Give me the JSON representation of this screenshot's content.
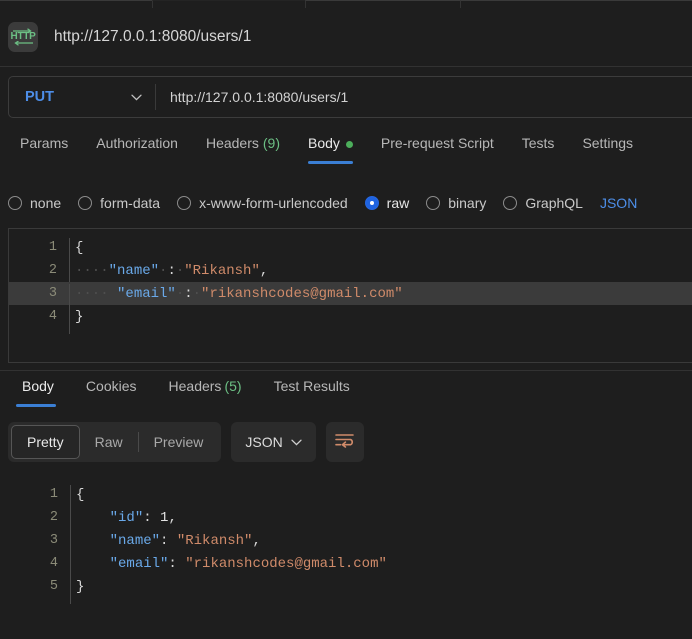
{
  "window": {
    "request_title": "http://127.0.0.1:8080/users/1",
    "protocol_icon_label": "HTTP"
  },
  "urlbar": {
    "method": "PUT",
    "method_dropdown_icon": "chevron-down-icon",
    "url_value": "http://127.0.0.1:8080/users/1"
  },
  "request_tabs": [
    {
      "label": "Params",
      "count": "",
      "active": false,
      "dot": false
    },
    {
      "label": "Authorization",
      "count": "",
      "active": false,
      "dot": false
    },
    {
      "label": "Headers",
      "count": "(9)",
      "active": false,
      "dot": false
    },
    {
      "label": "Body",
      "count": "",
      "active": true,
      "dot": true
    },
    {
      "label": "Pre-request Script",
      "count": "",
      "active": false,
      "dot": false
    },
    {
      "label": "Tests",
      "count": "",
      "active": false,
      "dot": false
    },
    {
      "label": "Settings",
      "count": "",
      "active": false,
      "dot": false
    }
  ],
  "body_type_options": [
    {
      "label": "none",
      "selected": false
    },
    {
      "label": "form-data",
      "selected": false
    },
    {
      "label": "x-www-form-urlencoded",
      "selected": false
    },
    {
      "label": "raw",
      "selected": true
    },
    {
      "label": "binary",
      "selected": false
    },
    {
      "label": "GraphQL",
      "selected": false
    }
  ],
  "body_format_chip": "JSON",
  "request_body": {
    "lines": [
      {
        "n": "1",
        "tokens": [
          {
            "t": "punct",
            "v": "{"
          }
        ],
        "highlight": false,
        "guide": true
      },
      {
        "n": "2",
        "tokens": [
          {
            "t": "ws",
            "v": "····"
          },
          {
            "t": "key",
            "v": "\"name\""
          },
          {
            "t": "ws",
            "v": "·"
          },
          {
            "t": "punct",
            "v": ":"
          },
          {
            "t": "ws",
            "v": "·"
          },
          {
            "t": "str",
            "v": "\"Rikansh\""
          },
          {
            "t": "punct",
            "v": ","
          }
        ],
        "highlight": false,
        "guide": true
      },
      {
        "n": "3",
        "tokens": [
          {
            "t": "ws",
            "v": "····"
          },
          {
            "t": "key",
            "v": " \"email\""
          },
          {
            "t": "ws",
            "v": "·"
          },
          {
            "t": "punct",
            "v": ":"
          },
          {
            "t": "ws",
            "v": "·"
          },
          {
            "t": "str",
            "v": "\"rikanshcodes@gmail.com\""
          }
        ],
        "highlight": true,
        "guide": true
      },
      {
        "n": "4",
        "tokens": [
          {
            "t": "punct",
            "v": "}"
          }
        ],
        "highlight": false,
        "guide": true
      }
    ]
  },
  "response_tabs": [
    {
      "label": "Body",
      "count": "",
      "active": true
    },
    {
      "label": "Cookies",
      "count": "",
      "active": false
    },
    {
      "label": "Headers",
      "count": "(5)",
      "active": false
    },
    {
      "label": "Test Results",
      "count": "",
      "active": false
    }
  ],
  "response_toolbar": {
    "view_modes": [
      {
        "label": "Pretty",
        "active": true
      },
      {
        "label": "Raw",
        "active": false
      },
      {
        "label": "Preview",
        "active": false
      }
    ],
    "format": "JSON",
    "format_dropdown_icon": "chevron-down-icon",
    "wrap_button_icon": "word-wrap-icon"
  },
  "response_body": {
    "lines": [
      {
        "n": "1",
        "tokens": [
          {
            "t": "punct",
            "v": "{"
          }
        ],
        "guide": true
      },
      {
        "n": "2",
        "tokens": [
          {
            "t": "ws",
            "v": "    "
          },
          {
            "t": "key",
            "v": "\"id\""
          },
          {
            "t": "punct",
            "v": ":"
          },
          {
            "t": "ws",
            "v": " "
          },
          {
            "t": "num",
            "v": "1"
          },
          {
            "t": "punct",
            "v": ","
          }
        ],
        "guide": true
      },
      {
        "n": "3",
        "tokens": [
          {
            "t": "ws",
            "v": "    "
          },
          {
            "t": "key",
            "v": "\"name\""
          },
          {
            "t": "punct",
            "v": ":"
          },
          {
            "t": "ws",
            "v": " "
          },
          {
            "t": "str",
            "v": "\"Rikansh\""
          },
          {
            "t": "punct",
            "v": ","
          }
        ],
        "guide": true
      },
      {
        "n": "4",
        "tokens": [
          {
            "t": "ws",
            "v": "    "
          },
          {
            "t": "key",
            "v": "\"email\""
          },
          {
            "t": "punct",
            "v": ":"
          },
          {
            "t": "ws",
            "v": " "
          },
          {
            "t": "str",
            "v": "\"rikanshcodes@gmail.com\""
          }
        ],
        "guide": true
      },
      {
        "n": "5",
        "tokens": [
          {
            "t": "punct",
            "v": "}"
          }
        ],
        "guide": true
      }
    ]
  },
  "colors": {
    "accent_blue": "#3b7fd4",
    "method_blue": "#4d8ee8",
    "count_green": "#6cbf84",
    "string_orange": "#d08b6a",
    "key_blue": "#6aa9e9",
    "background": "#1e1e1e"
  }
}
